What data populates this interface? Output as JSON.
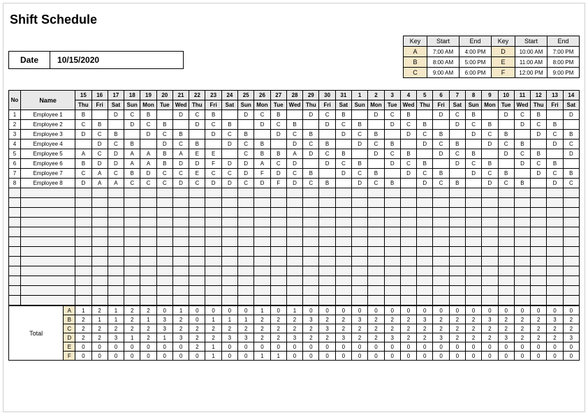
{
  "title": "Shift Schedule",
  "date": {
    "label": "Date",
    "value": "10/15/2020"
  },
  "key_legend": {
    "headers": [
      "Key",
      "Start",
      "End",
      "Key",
      "Start",
      "End"
    ],
    "rows": [
      [
        "A",
        "7:00 AM",
        "4:00 PM",
        "D",
        "10:00 AM",
        "7:00 PM"
      ],
      [
        "B",
        "8:00 AM",
        "5:00 PM",
        "E",
        "11:00 AM",
        "8:00 PM"
      ],
      [
        "C",
        "9:00 AM",
        "6:00 PM",
        "F",
        "12:00 PM",
        "9:00 PM"
      ]
    ]
  },
  "schedule": {
    "no_header": "No",
    "name_header": "Name",
    "day_numbers": [
      "15",
      "16",
      "17",
      "18",
      "19",
      "20",
      "21",
      "22",
      "23",
      "24",
      "25",
      "26",
      "27",
      "28",
      "29",
      "30",
      "31",
      "1",
      "2",
      "3",
      "4",
      "5",
      "6",
      "7",
      "8",
      "9",
      "10",
      "11",
      "12",
      "13",
      "14"
    ],
    "day_names": [
      "Thu",
      "Fri",
      "Sat",
      "Sun",
      "Mon",
      "Tue",
      "Wed",
      "Thu",
      "Fri",
      "Sat",
      "Sun",
      "Mon",
      "Tue",
      "Wed",
      "Thu",
      "Fri",
      "Sat",
      "Sun",
      "Mon",
      "Tue",
      "Wed",
      "Thu",
      "Fri",
      "Sat",
      "Sun",
      "Mon",
      "Tue",
      "Wed",
      "Thu",
      "Fri",
      "Sat"
    ],
    "employees": [
      {
        "no": "1",
        "name": "Employee 1",
        "shifts": [
          "B",
          "",
          "D",
          "C",
          "B",
          "",
          "D",
          "C",
          "B",
          "",
          "D",
          "C",
          "B",
          "",
          "D",
          "C",
          "B",
          "",
          "D",
          "C",
          "B",
          "",
          "D",
          "C",
          "B",
          "",
          "D",
          "C",
          "B",
          "",
          "D"
        ]
      },
      {
        "no": "2",
        "name": "Employee 2",
        "shifts": [
          "C",
          "B",
          "",
          "D",
          "C",
          "B",
          "",
          "D",
          "C",
          "B",
          "",
          "D",
          "C",
          "B",
          "",
          "D",
          "C",
          "B",
          "",
          "D",
          "C",
          "B",
          "",
          "D",
          "C",
          "B",
          "",
          "D",
          "C",
          "B",
          ""
        ]
      },
      {
        "no": "3",
        "name": "Employee 3",
        "shifts": [
          "D",
          "C",
          "B",
          "",
          "D",
          "C",
          "B",
          "",
          "D",
          "C",
          "B",
          "",
          "D",
          "C",
          "B",
          "",
          "D",
          "C",
          "B",
          "",
          "D",
          "C",
          "B",
          "",
          "D",
          "C",
          "B",
          "",
          "D",
          "C",
          "B"
        ]
      },
      {
        "no": "4",
        "name": "Employee 4",
        "shifts": [
          "",
          "D",
          "C",
          "B",
          "",
          "D",
          "C",
          "B",
          "",
          "D",
          "C",
          "B",
          "",
          "D",
          "C",
          "B",
          "",
          "D",
          "C",
          "B",
          "",
          "D",
          "C",
          "B",
          "",
          "D",
          "C",
          "B",
          "",
          "D",
          "C"
        ]
      },
      {
        "no": "5",
        "name": "Employee 5",
        "shifts": [
          "A",
          "C",
          "D",
          "A",
          "A",
          "B",
          "A",
          "E",
          "E",
          "",
          "C",
          "B",
          "B",
          "A",
          "D",
          "C",
          "B",
          "",
          "D",
          "C",
          "B",
          "",
          "D",
          "C",
          "B",
          "",
          "D",
          "C",
          "B",
          "",
          "D"
        ]
      },
      {
        "no": "6",
        "name": "Employee 6",
        "shifts": [
          "B",
          "D",
          "D",
          "A",
          "A",
          "B",
          "D",
          "D",
          "F",
          "D",
          "D",
          "A",
          "C",
          "D",
          "",
          "D",
          "C",
          "B",
          "",
          "D",
          "C",
          "B",
          "",
          "D",
          "C",
          "B",
          "",
          "D",
          "C",
          "B",
          ""
        ]
      },
      {
        "no": "7",
        "name": "Employee 7",
        "shifts": [
          "C",
          "A",
          "C",
          "B",
          "D",
          "C",
          "C",
          "E",
          "C",
          "C",
          "D",
          "F",
          "D",
          "C",
          "B",
          "",
          "D",
          "C",
          "B",
          "",
          "D",
          "C",
          "B",
          "",
          "D",
          "C",
          "B",
          "",
          "D",
          "C",
          "B"
        ]
      },
      {
        "no": "8",
        "name": "Employee 8",
        "shifts": [
          "D",
          "A",
          "A",
          "C",
          "C",
          "C",
          "D",
          "C",
          "D",
          "D",
          "C",
          "D",
          "F",
          "D",
          "C",
          "B",
          "",
          "D",
          "C",
          "B",
          "",
          "D",
          "C",
          "B",
          "",
          "D",
          "C",
          "B",
          "",
          "D",
          "C"
        ]
      }
    ],
    "blank_rows": 12
  },
  "totals": {
    "label": "Total",
    "keys": [
      "A",
      "B",
      "C",
      "D",
      "E",
      "F"
    ],
    "rows": [
      [
        "1",
        "2",
        "1",
        "2",
        "2",
        "0",
        "1",
        "0",
        "0",
        "0",
        "0",
        "1",
        "0",
        "1",
        "0",
        "0",
        "0",
        "0",
        "0",
        "0",
        "0",
        "0",
        "0",
        "0",
        "0",
        "0",
        "0",
        "0",
        "0",
        "0",
        "0"
      ],
      [
        "2",
        "1",
        "1",
        "2",
        "1",
        "3",
        "2",
        "0",
        "1",
        "1",
        "1",
        "2",
        "2",
        "2",
        "3",
        "2",
        "2",
        "3",
        "2",
        "2",
        "2",
        "3",
        "2",
        "2",
        "2",
        "3",
        "2",
        "2",
        "2",
        "3",
        "2"
      ],
      [
        "2",
        "2",
        "2",
        "2",
        "2",
        "3",
        "2",
        "2",
        "2",
        "2",
        "2",
        "2",
        "2",
        "2",
        "2",
        "3",
        "2",
        "2",
        "2",
        "2",
        "2",
        "2",
        "2",
        "2",
        "2",
        "2",
        "2",
        "2",
        "2",
        "2",
        "2"
      ],
      [
        "2",
        "2",
        "3",
        "1",
        "2",
        "1",
        "3",
        "2",
        "2",
        "3",
        "3",
        "2",
        "2",
        "3",
        "2",
        "2",
        "3",
        "2",
        "2",
        "3",
        "2",
        "2",
        "3",
        "2",
        "2",
        "2",
        "3",
        "2",
        "2",
        "2",
        "3"
      ],
      [
        "0",
        "0",
        "0",
        "0",
        "0",
        "0",
        "0",
        "2",
        "1",
        "0",
        "0",
        "0",
        "0",
        "0",
        "0",
        "0",
        "0",
        "0",
        "0",
        "0",
        "0",
        "0",
        "0",
        "0",
        "0",
        "0",
        "0",
        "0",
        "0",
        "0",
        "0"
      ],
      [
        "0",
        "0",
        "0",
        "0",
        "0",
        "0",
        "0",
        "0",
        "1",
        "0",
        "0",
        "1",
        "1",
        "0",
        "0",
        "0",
        "0",
        "0",
        "0",
        "0",
        "0",
        "0",
        "0",
        "0",
        "0",
        "0",
        "0",
        "0",
        "0",
        "0",
        "0"
      ]
    ]
  }
}
